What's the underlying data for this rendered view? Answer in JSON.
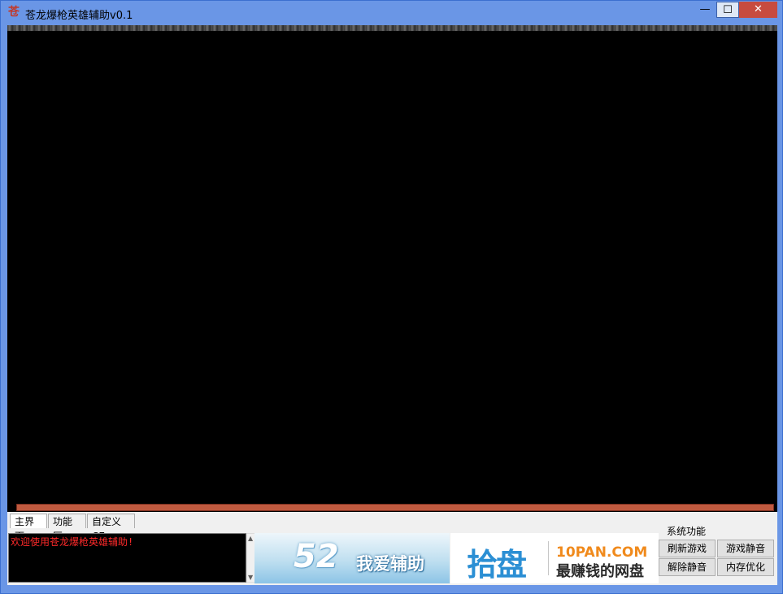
{
  "window": {
    "title": "苍龙爆枪英雄辅助v0.1",
    "icon_glyph": "苍",
    "minimize_glyph": "—",
    "maximize_glyph": "☐",
    "close_glyph": "✕"
  },
  "tabs": [
    {
      "label": "主界面",
      "active": true
    },
    {
      "label": "功能区",
      "active": false
    },
    {
      "label": "自定义CE",
      "active": false
    }
  ],
  "log": {
    "text": "欢迎使用苍龙爆枪英雄辅助!"
  },
  "ads": {
    "ad1_number": "52",
    "ad1_text": "我爱辅助",
    "ad2_logo": "拾盘",
    "ad2_domain": "10PAN.COM",
    "ad2_slogan": "最赚钱的网盘"
  },
  "system": {
    "group_label": "系统功能",
    "buttons": [
      "刷新游戏",
      "游戏静音",
      "解除静音",
      "内存优化"
    ]
  },
  "colors": {
    "titlebar": "#6a96e6",
    "close": "#c74b3f",
    "log_text": "#ff2a2a",
    "progress": "#b0503a"
  }
}
